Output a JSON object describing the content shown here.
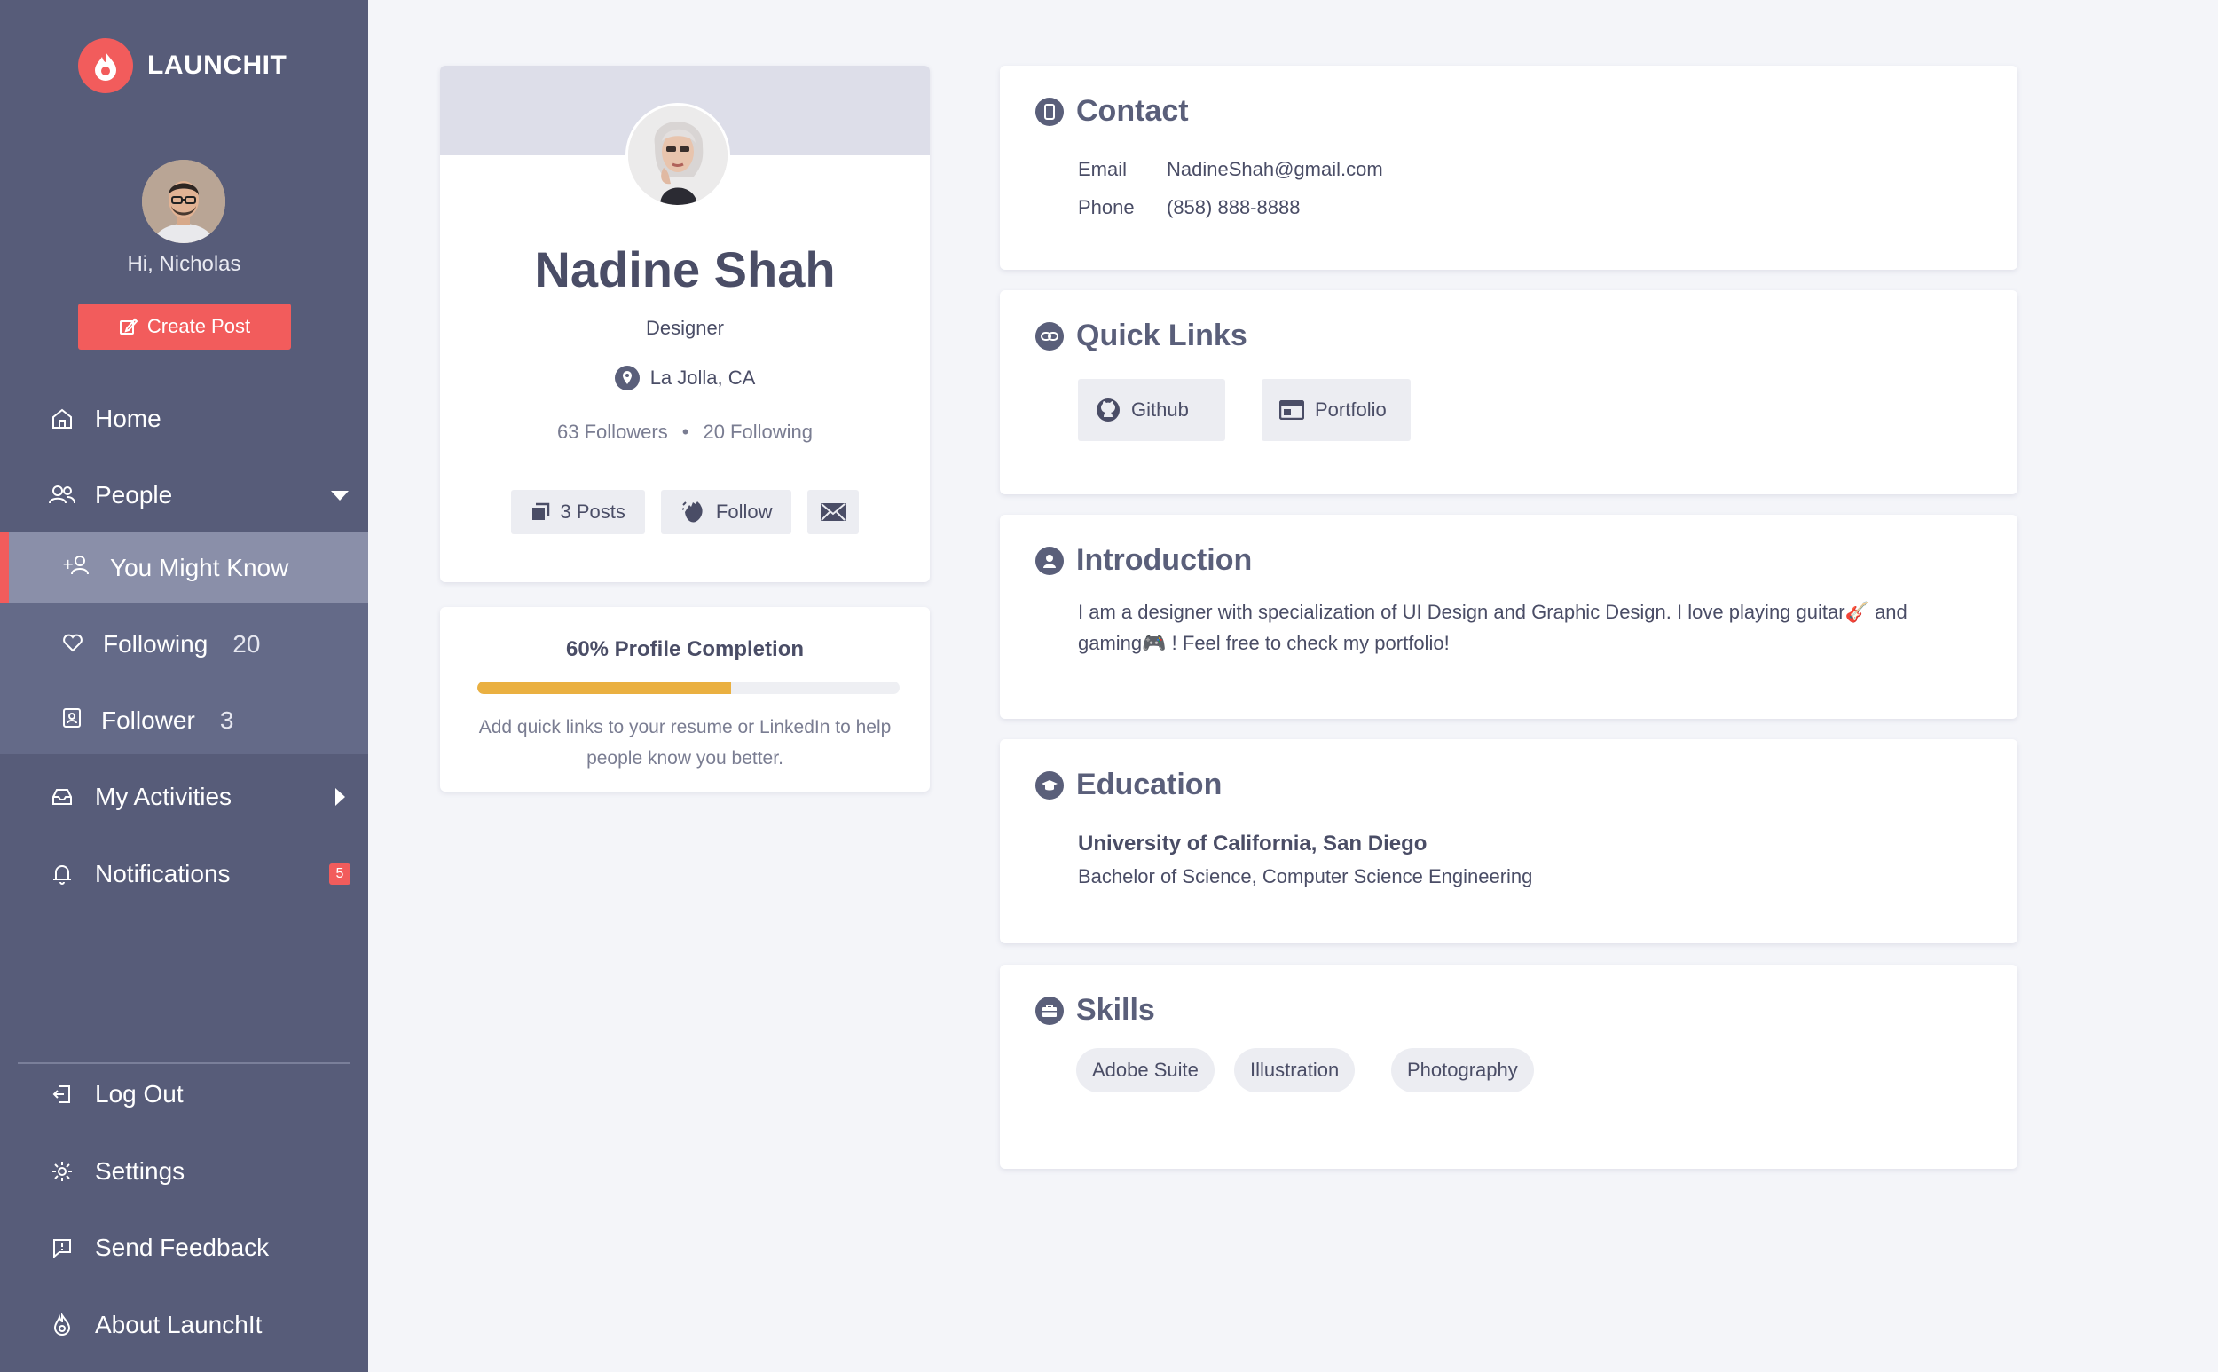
{
  "brand": {
    "name": "LAUNCHIT",
    "accent": "#f25c5c"
  },
  "user": {
    "greeting": "Hi, Nicholas",
    "create_post_label": "Create Post"
  },
  "sidebar": {
    "nav": [
      {
        "label": "Home"
      },
      {
        "label": "People"
      }
    ],
    "people_sub": [
      {
        "label": "You Might Know"
      },
      {
        "label": "Following",
        "count": "20"
      },
      {
        "label": "Follower",
        "count": "3"
      }
    ],
    "activities": {
      "label": "My Activities"
    },
    "notifications": {
      "label": "Notifications",
      "badge": "5"
    },
    "bottom": [
      {
        "label": "Log Out"
      },
      {
        "label": "Settings"
      },
      {
        "label": "Send Feedback"
      },
      {
        "label": "About LaunchIt"
      }
    ]
  },
  "profile": {
    "name": "Nadine Shah",
    "role": "Designer",
    "location": "La Jolla, CA",
    "followers": "63 Followers",
    "separator": "•",
    "following": "20 Following",
    "posts_label": "3 Posts",
    "follow_label": "Follow"
  },
  "completion": {
    "title": "60% Profile Completion",
    "progress": 0.6,
    "hint": "Add quick links to your resume or LinkedIn to help people know you better."
  },
  "contact": {
    "title": "Contact",
    "email_label": "Email",
    "email": "NadineShah@gmail.com",
    "phone_label": "Phone",
    "phone": "(858) 888-8888"
  },
  "quick_links": {
    "title": "Quick Links",
    "github": "Github",
    "portfolio": "Portfolio"
  },
  "introduction": {
    "title": "Introduction",
    "text": "I am a designer with specialization of UI Design and Graphic Design. I love playing guitar🎸 and gaming🎮 ! Feel free to check my portfolio!"
  },
  "education": {
    "title": "Education",
    "school": "University of California, San Diego",
    "degree": "Bachelor of Science, Computer Science Engineering"
  },
  "skills": {
    "title": "Skills",
    "items": [
      "Adobe Suite",
      "Illustration",
      "Photography"
    ]
  }
}
